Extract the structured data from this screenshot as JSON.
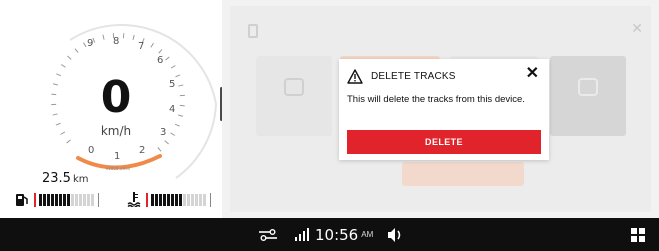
{
  "cluster": {
    "gear": "0",
    "speed_unit": "km/h",
    "rpm_scale": [
      "0",
      "1",
      "2",
      "3",
      "4",
      "5",
      "6",
      "7",
      "8",
      "9"
    ],
    "odometer_value": "23.5",
    "odometer_unit": "km",
    "fuel_level": 0.55,
    "temp_level": 0.55,
    "accent_color": "#f08a4b"
  },
  "dialog": {
    "title": "DELETE TRACKS",
    "message": "This will delete the tracks from this device.",
    "delete_label": "DELETE",
    "close_icon": "close-icon",
    "warning_icon": "warning-icon",
    "button_color": "#e1242b"
  },
  "statusbar": {
    "time": "10:56",
    "ampm": "AM",
    "icons": [
      "riding-mode-icon",
      "signal-icon",
      "volume-icon",
      "grid-menu-icon"
    ]
  }
}
